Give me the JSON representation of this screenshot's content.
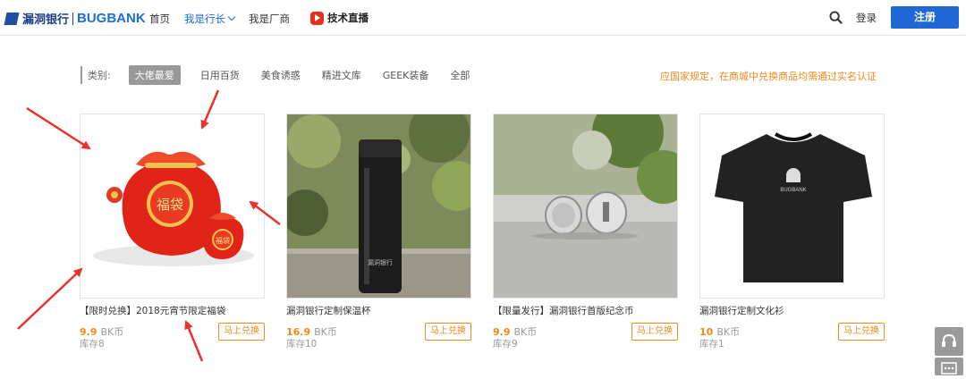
{
  "header": {
    "logo_cn": "漏洞银行",
    "logo_en": "BUGBANK",
    "nav": [
      {
        "label": "首页"
      },
      {
        "label": "我是行长"
      },
      {
        "label": "我是厂商"
      }
    ],
    "live_label": "技术直播",
    "login_label": "登录",
    "register_label": "注册"
  },
  "filters": {
    "label": "类别:",
    "items": [
      "大佬最爱",
      "日用百货",
      "美食诱惑",
      "精进文库",
      "GEEK装备",
      "全部"
    ],
    "active_index": 0,
    "notice": "应国家规定，在商城中兑换商品均需通过实名认证"
  },
  "products": [
    {
      "title": "【限时兑换】2018元宵节限定福袋",
      "price": "9.9",
      "currency": "BK币",
      "stock": "库存8",
      "button": "马上兑换"
    },
    {
      "title": "漏洞银行定制保温杯",
      "price": "16.9",
      "currency": "BK币",
      "stock": "库存10",
      "button": "马上兑换"
    },
    {
      "title": "【限量发行】漏洞银行首版纪念币",
      "price": "9.9",
      "currency": "BK币",
      "stock": "库存9",
      "button": "马上兑换"
    },
    {
      "title": "漏洞银行定制文化衫",
      "price": "10",
      "currency": "BK币",
      "stock": "库存1",
      "button": "马上兑换"
    }
  ],
  "thumb_texts": {
    "bag_big": "福袋",
    "bag_small": "福袋",
    "bottle_brand": "漏洞银行",
    "shirt_brand": "BUGBANK"
  },
  "colors": {
    "brand_blue": "#2067d6",
    "accent_orange": "#f08a1b",
    "arrow_red": "#e8322a"
  }
}
